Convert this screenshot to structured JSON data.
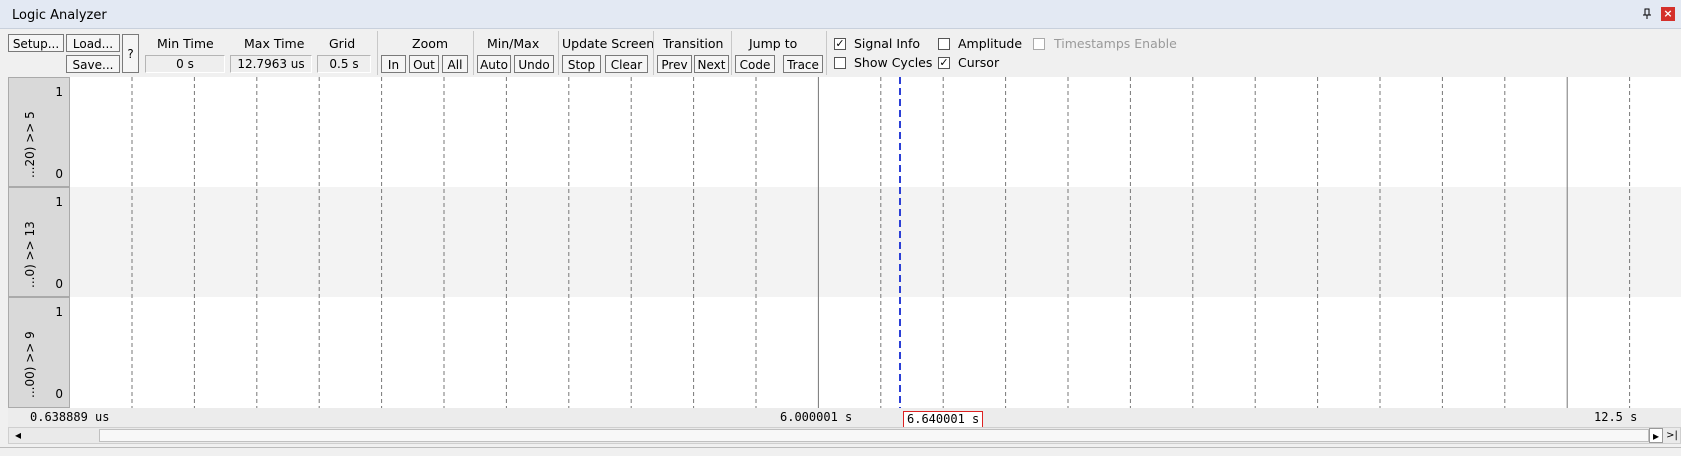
{
  "window": {
    "title": "Logic Analyzer",
    "pin_icon": "pin-icon",
    "close_icon": "close-icon"
  },
  "toolbar": {
    "setup": "Setup...",
    "load": "Load...",
    "save": "Save...",
    "help": "?",
    "min_time_label": "Min Time",
    "min_time_value": "0 s",
    "max_time_label": "Max Time",
    "max_time_value": "12.7963 us",
    "grid_label": "Grid",
    "grid_value": "0.5 s",
    "zoom_label": "Zoom",
    "zoom_in": "In",
    "zoom_out": "Out",
    "zoom_all": "All",
    "minmax_label": "Min/Max",
    "minmax_auto": "Auto",
    "minmax_undo": "Undo",
    "update_label": "Update Screen",
    "update_stop": "Stop",
    "update_clear": "Clear",
    "transition_label": "Transition",
    "transition_prev": "Prev",
    "transition_next": "Next",
    "jump_label": "Jump to",
    "jump_code": "Code",
    "jump_trace": "Trace",
    "signal_info": {
      "label": "Signal Info",
      "checked": true
    },
    "amplitude": {
      "label": "Amplitude",
      "checked": false
    },
    "timestamps": {
      "label": "Timestamps Enable",
      "checked": false,
      "disabled": true
    },
    "show_cycles": {
      "label": "Show Cycles",
      "checked": false
    },
    "cursor": {
      "label": "Cursor",
      "checked": true
    },
    "check_mark": "✓"
  },
  "signals": [
    {
      "name": "...20) >> 5",
      "high": "1",
      "low": "0"
    },
    {
      "name": "...0) >> 13",
      "high": "1",
      "low": "0"
    },
    {
      "name": "...00) >> 9",
      "high": "1",
      "low": "0"
    }
  ],
  "timeline": {
    "start": "0.638889 us",
    "mid": "6.000001  s",
    "cursor": "6.640001  s",
    "end": "12.5  s",
    "cursor_color": "#2b3fd6"
  },
  "scrollbar": {
    "left_arrow": "◂",
    "right_arrow": "▸",
    "end_arrow": ">|"
  }
}
